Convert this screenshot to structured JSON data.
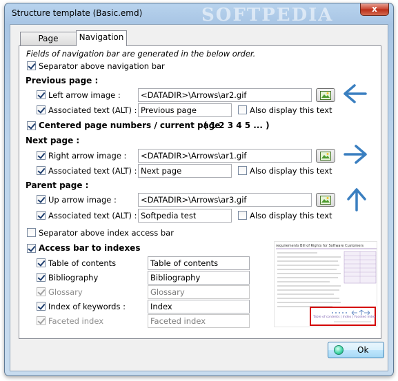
{
  "window": {
    "title": "Structure template (Basic.emd)",
    "watermark": "SOFTPEDIA",
    "close_glyph": "x"
  },
  "tabs": [
    {
      "label": "Page",
      "active": false
    },
    {
      "label": "Navigation",
      "active": true
    }
  ],
  "nav": {
    "intro": "Fields of navigation bar are generated in the below order.",
    "separator_nav_label": "Separator above navigation bar",
    "separator_nav_checked": true,
    "previous": {
      "heading": "Previous page :",
      "arrow_label": "Left arrow image :",
      "arrow_checked": true,
      "arrow_value": "<DATADIR>\\Arrows\\ar2.gif",
      "alt_label": "Associated text (ALT) :",
      "alt_checked": true,
      "alt_value": "Previous page",
      "also_label": "Also display this text",
      "also_checked": false,
      "arrow_icon": "left-arrow-icon"
    },
    "centered": {
      "label": "Centered page numbers / current page",
      "suffix": ":  ( 1 2 3 4 5 ... )",
      "checked": true
    },
    "next": {
      "heading": "Next page :",
      "arrow_label": "Right arrow image :",
      "arrow_checked": true,
      "arrow_value": "<DATADIR>\\Arrows\\ar1.gif",
      "alt_label": "Associated text (ALT) :",
      "alt_checked": true,
      "alt_value": "Next page",
      "also_label": "Also display this text",
      "also_checked": false,
      "arrow_icon": "right-arrow-icon"
    },
    "parent": {
      "heading": "Parent page :",
      "arrow_label": "Up arrow image :",
      "arrow_checked": true,
      "arrow_value": "<DATADIR>\\Arrows\\ar3.gif",
      "alt_label": "Associated text (ALT) :",
      "alt_checked": true,
      "alt_value": "Softpedia test",
      "also_label": "Also display this text",
      "also_checked": false,
      "arrow_icon": "up-arrow-icon"
    },
    "separator_index_label": "Separator above index access bar",
    "separator_index_checked": false,
    "access_bar": {
      "label": "Access bar to indexes",
      "checked": true,
      "items": [
        {
          "label": "Table of contents",
          "value": "Table of contents",
          "checked": true,
          "enabled": true
        },
        {
          "label": "Bibliography",
          "value": "Bibliography",
          "checked": true,
          "enabled": true
        },
        {
          "label": "Glossary",
          "value": "Glossary",
          "checked": true,
          "enabled": false
        },
        {
          "label": "Index of keywords :",
          "value": "Index",
          "checked": true,
          "enabled": true
        },
        {
          "label": "Faceted index",
          "value": "Faceted index",
          "checked": true,
          "enabled": false
        }
      ]
    }
  },
  "preview": {
    "heading": "requirements Bill of Rights for Software Customers",
    "nav_hint": "Table of contents | Index | Faceted index"
  },
  "footer": {
    "ok_label": "Ok"
  },
  "colors": {
    "arrow_blue": "#3a7fc0",
    "highlight_red": "#d40000"
  }
}
